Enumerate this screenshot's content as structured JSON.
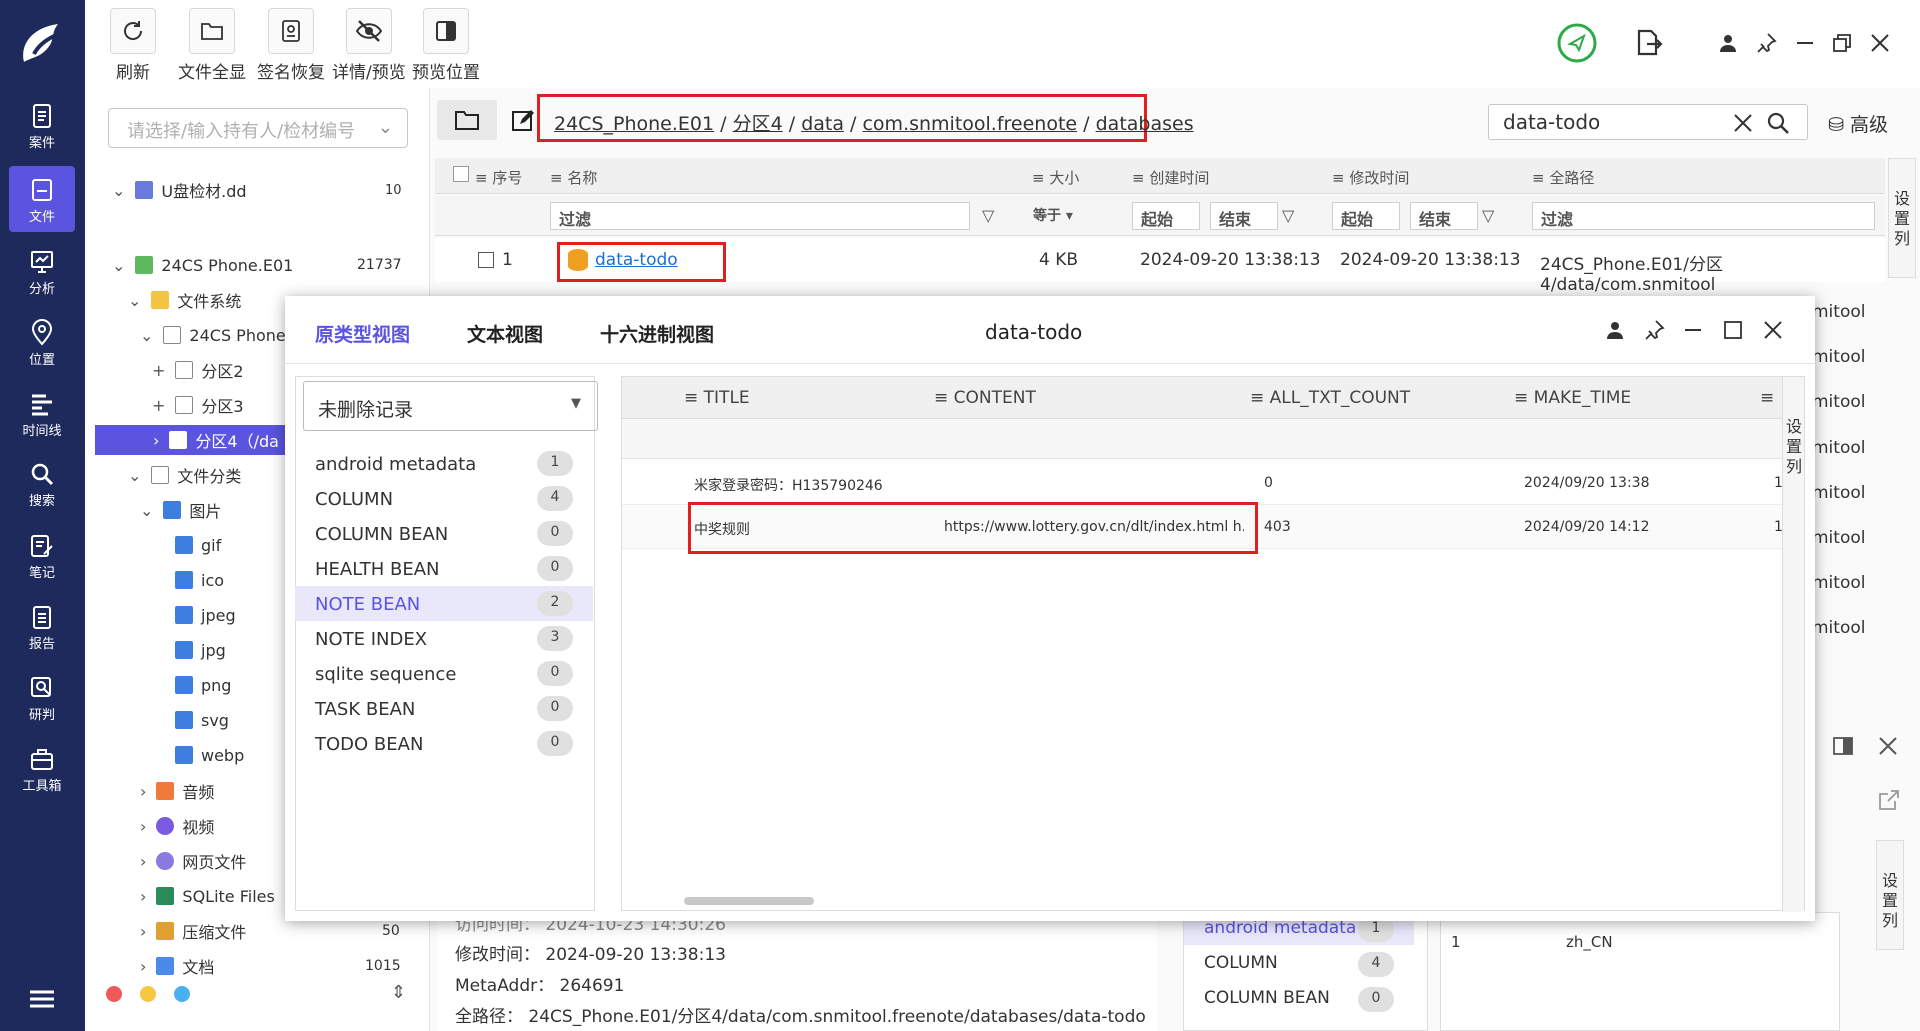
{
  "toolbar": {
    "buttons": [
      {
        "label": "刷新",
        "icon": "refresh-icon"
      },
      {
        "label": "文件全显",
        "icon": "folder-icon"
      },
      {
        "label": "签名恢复",
        "icon": "signature-icon"
      },
      {
        "label": "详情/预览",
        "icon": "eye-off-icon"
      },
      {
        "label": "预览位置",
        "icon": "panel-icon"
      }
    ],
    "advanced_label": "高级"
  },
  "sidebar": {
    "items": [
      {
        "label": "案件",
        "icon": "case-icon"
      },
      {
        "label": "文件",
        "icon": "file-icon"
      },
      {
        "label": "分析",
        "icon": "analysis-icon"
      },
      {
        "label": "位置",
        "icon": "location-icon"
      },
      {
        "label": "时间线",
        "icon": "timeline-icon"
      },
      {
        "label": "搜索",
        "icon": "search-icon"
      },
      {
        "label": "笔记",
        "icon": "note-icon"
      },
      {
        "label": "报告",
        "icon": "report-icon"
      },
      {
        "label": "研判",
        "icon": "judge-icon"
      },
      {
        "label": "工具箱",
        "icon": "toolbox-icon"
      }
    ]
  },
  "left_panel": {
    "select_placeholder": "请选择/输入持有人/检材编号",
    "tree": [
      {
        "label": "U盘检材.dd",
        "count": "10"
      },
      {
        "label": "24CS Phone.E01",
        "count": "21737"
      },
      {
        "label": "文件系统",
        "count": ""
      },
      {
        "label": "24CS Phone",
        "count": ""
      },
      {
        "label": "分区2",
        "count": ""
      },
      {
        "label": "分区3",
        "count": ""
      },
      {
        "label": "分区4（/da",
        "count": ""
      },
      {
        "label": "文件分类",
        "count": ""
      },
      {
        "label": "图片",
        "count": ""
      },
      {
        "label": "gif",
        "count": ""
      },
      {
        "label": "ico",
        "count": ""
      },
      {
        "label": "jpeg",
        "count": ""
      },
      {
        "label": "jpg",
        "count": ""
      },
      {
        "label": "png",
        "count": ""
      },
      {
        "label": "svg",
        "count": ""
      },
      {
        "label": "webp",
        "count": ""
      },
      {
        "label": "音频",
        "count": ""
      },
      {
        "label": "视频",
        "count": ""
      },
      {
        "label": "网页文件",
        "count": ""
      },
      {
        "label": "SQLite Files",
        "count": ""
      },
      {
        "label": "压缩文件",
        "count": "50"
      },
      {
        "label": "文档",
        "count": "1015"
      }
    ]
  },
  "path": {
    "segments": [
      "24CS_Phone.E01",
      "分区4",
      "data",
      "com.snmitool.freenote",
      "databases"
    ],
    "sep": "/"
  },
  "search": {
    "value": "data-todo"
  },
  "file_table": {
    "headers": [
      "序号",
      "名称",
      "大小",
      "创建时间",
      "修改时间",
      "全路径"
    ],
    "filters": {
      "name": "过滤",
      "size": "等于",
      "start1": "起始",
      "end1": "结束",
      "start2": "起始",
      "end2": "结束",
      "path": "过滤"
    },
    "row": {
      "index": "1",
      "name": "data-todo",
      "size": "4 KB",
      "created": "2024-09-20 13:38:13",
      "modified": "2024-09-20 13:38:13",
      "path": "24CS_Phone.E01/分区4/data/com.snmitool"
    },
    "path_tail": "mitool",
    "settings_label": "设置列"
  },
  "dialog": {
    "tabs": [
      "原类型视图",
      "文本视图",
      "十六进制视图"
    ],
    "title": "data-todo",
    "dropdown": "未删除记录",
    "tables": [
      {
        "name": "android metadata",
        "count": "1"
      },
      {
        "name": "COLUMN",
        "count": "4"
      },
      {
        "name": "COLUMN BEAN",
        "count": "0"
      },
      {
        "name": "HEALTH BEAN",
        "count": "0"
      },
      {
        "name": "NOTE BEAN",
        "count": "2"
      },
      {
        "name": "NOTE INDEX",
        "count": "3"
      },
      {
        "name": "sqlite sequence",
        "count": "0"
      },
      {
        "name": "TASK BEAN",
        "count": "0"
      },
      {
        "name": "TODO BEAN",
        "count": "0"
      }
    ],
    "grid": {
      "headers": [
        "TITLE",
        "CONTENT",
        "ALL_TXT_COUNT",
        "MAKE_TIME"
      ],
      "rows": [
        {
          "title": "米家登录密码：H135790246",
          "content": "",
          "count": "0",
          "time": "2024/09/20 13:38",
          "extra": "1"
        },
        {
          "title": "中奖规则",
          "content": "https://www.lottery.gov.cn/dlt/index.html h...",
          "count": "403",
          "time": "2024/09/20 14:12",
          "extra": "1"
        }
      ],
      "settings_label": "设置列"
    }
  },
  "details": {
    "access_label": "访问时间：",
    "access_value": "2024-10-23 14:30:26",
    "modified_label": "修改时间：",
    "modified_value": "2024-09-20 13:38:13",
    "meta_label": "MetaAddr：",
    "meta_value": "264691",
    "path_label": "全路径：",
    "path_value": "24CS_Phone.E01/分区4/data/com.snmitool.freenote/databases/data-todo"
  },
  "bottom_list": [
    {
      "name": "android metadata",
      "count": "1"
    },
    {
      "name": "COLUMN",
      "count": "4"
    },
    {
      "name": "COLUMN BEAN",
      "count": "0"
    }
  ],
  "bottom_grid": {
    "index": "1",
    "value": "zh_CN",
    "settings_label": "设置列"
  }
}
